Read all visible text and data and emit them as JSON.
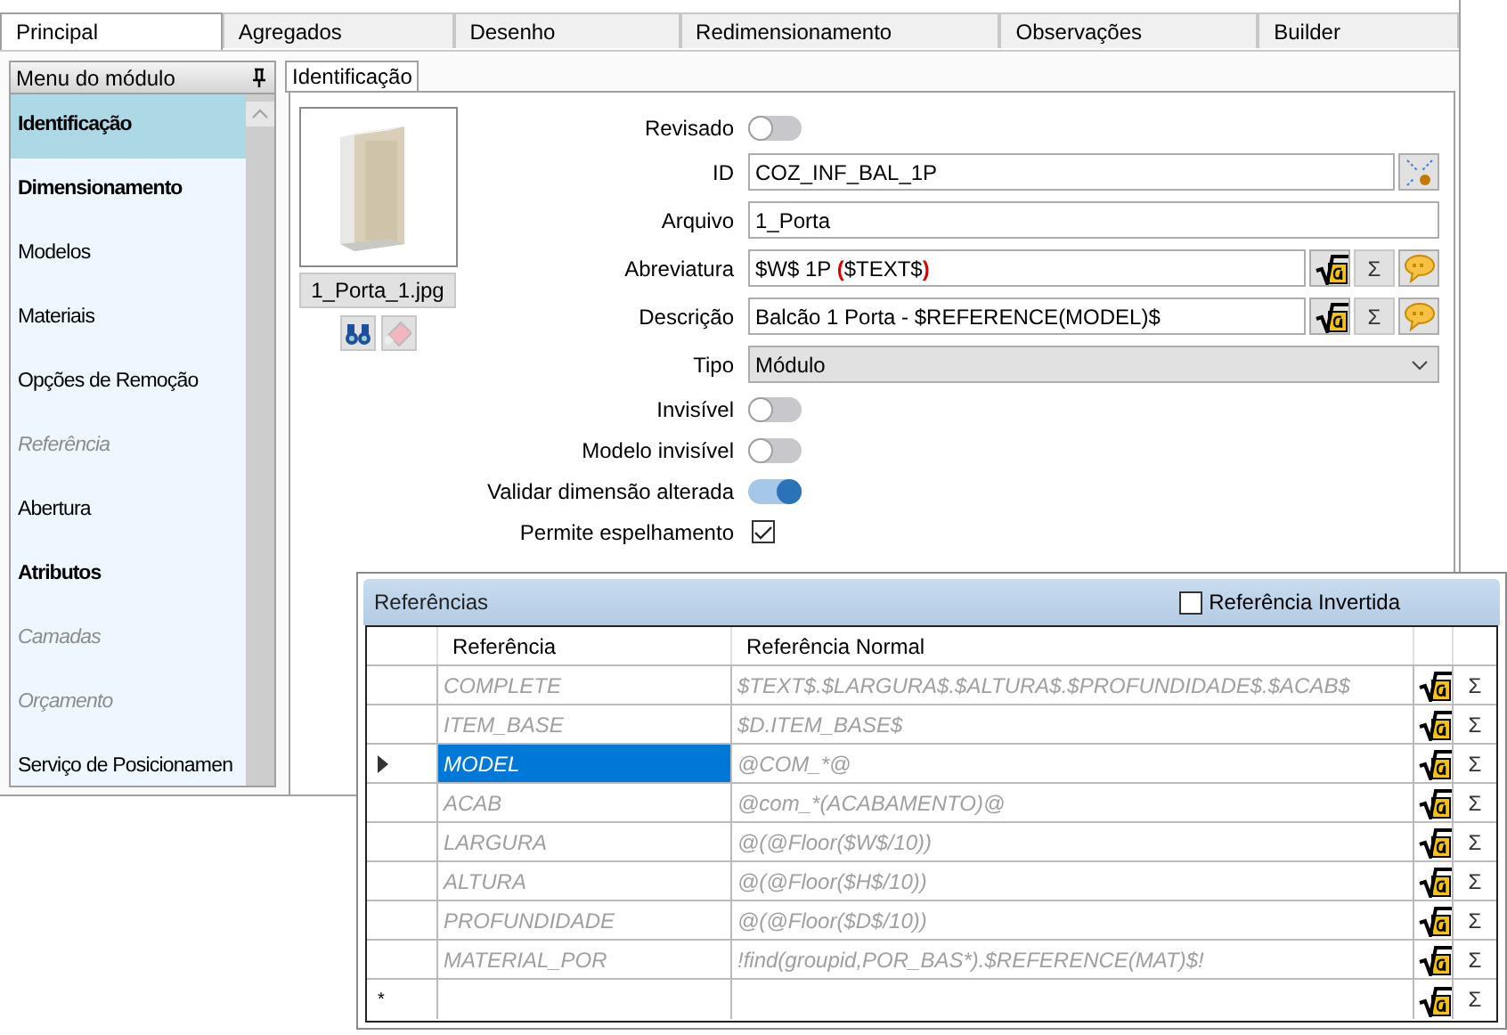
{
  "tabs": [
    {
      "label": "Principal",
      "selected": true
    },
    {
      "label": "Agregados",
      "selected": false
    },
    {
      "label": "Desenho",
      "selected": false
    },
    {
      "label": "Redimensionamento",
      "selected": false
    },
    {
      "label": "Observações",
      "selected": false
    },
    {
      "label": "Builder",
      "selected": false
    }
  ],
  "sidebar": {
    "title": "Menu do módulo",
    "items": [
      {
        "label": "Identificação",
        "selected": true,
        "bold": true,
        "disabled": false
      },
      {
        "label": "Dimensionamento",
        "selected": false,
        "bold": true,
        "disabled": false
      },
      {
        "label": "Modelos",
        "selected": false,
        "bold": false,
        "disabled": false
      },
      {
        "label": "Materiais",
        "selected": false,
        "bold": false,
        "disabled": false
      },
      {
        "label": "Opções de Remoção",
        "selected": false,
        "bold": false,
        "disabled": false
      },
      {
        "label": "Referência",
        "selected": false,
        "bold": false,
        "disabled": true
      },
      {
        "label": "Abertura",
        "selected": false,
        "bold": false,
        "disabled": false
      },
      {
        "label": "Atributos",
        "selected": false,
        "bold": true,
        "disabled": false
      },
      {
        "label": "Camadas",
        "selected": false,
        "bold": false,
        "disabled": true
      },
      {
        "label": "Orçamento",
        "selected": false,
        "bold": false,
        "disabled": true
      },
      {
        "label": "Serviço de Posicionamen",
        "selected": false,
        "bold": false,
        "disabled": false
      }
    ]
  },
  "content_tab": {
    "label": "Identificação"
  },
  "image": {
    "kind": "picture",
    "filename": "1_Porta_1.jpg"
  },
  "fields": [
    {
      "kind": "toggle",
      "label": "Revisado",
      "on": false
    },
    {
      "kind": "id",
      "label": "ID",
      "value": "COZ_INF_BAL_1P"
    },
    {
      "kind": "text",
      "label": "Arquivo",
      "value": "1_Porta"
    },
    {
      "kind": "formula",
      "label": "Abreviatura",
      "segments": [
        {
          "text": "$W$ 1P ",
          "highlighted": false
        },
        {
          "text": "(",
          "highlighted": true
        },
        {
          "text": "$TEXT$",
          "highlighted": false
        },
        {
          "text": ")",
          "highlighted": true
        }
      ],
      "sum_button": "Σ"
    },
    {
      "kind": "formula",
      "label": "Descrição",
      "segments": [
        {
          "text": "Balcão 1 Porta - $REFERENCE(MODEL)$",
          "highlighted": false
        }
      ],
      "sum_button": "Σ"
    },
    {
      "kind": "select",
      "label": "Tipo",
      "value": "Módulo"
    },
    {
      "kind": "toggle",
      "label": "Invisível",
      "on": false
    },
    {
      "kind": "toggle",
      "label": "Modelo invisível",
      "on": false
    },
    {
      "kind": "toggle",
      "label": "Validar dimensão alterada",
      "on": true
    },
    {
      "kind": "checkbox",
      "label": "Permite espelhamento",
      "checked": true
    }
  ],
  "references": {
    "title": "Referências",
    "inverted": {
      "label": "Referência Invertida",
      "checked": false
    },
    "columns": [
      "Referência",
      "Referência Normal"
    ],
    "rows": [
      {
        "reference": "COMPLETE",
        "normal": "$TEXT$.$LARGURA$.$ALTURA$.$PROFUNDIDADE$.$ACAB$",
        "selected": false,
        "sum_button": "Σ"
      },
      {
        "reference": "ITEM_BASE",
        "normal": "$D.ITEM_BASE$",
        "selected": false,
        "sum_button": "Σ"
      },
      {
        "reference": "MODEL",
        "normal": "@COM_*@",
        "selected": true,
        "sum_button": "Σ"
      },
      {
        "reference": "ACAB",
        "normal": "@com_*(ACABAMENTO)@",
        "selected": false,
        "sum_button": "Σ"
      },
      {
        "reference": "LARGURA",
        "normal": "@(@Floor($W$/10))",
        "selected": false,
        "sum_button": "Σ"
      },
      {
        "reference": "ALTURA",
        "normal": "@(@Floor($H$/10))",
        "selected": false,
        "sum_button": "Σ"
      },
      {
        "reference": "PROFUNDIDADE",
        "normal": "@(@Floor($D$/10))",
        "selected": false,
        "sum_button": "Σ"
      },
      {
        "reference": "MATERIAL_POR",
        "normal": "!find(groupid,POR_BAS*).$REFERENCE(MAT)$!",
        "selected": false,
        "sum_button": "Σ"
      }
    ],
    "new_row": {
      "marker": "*",
      "sum_button": "Σ"
    }
  }
}
